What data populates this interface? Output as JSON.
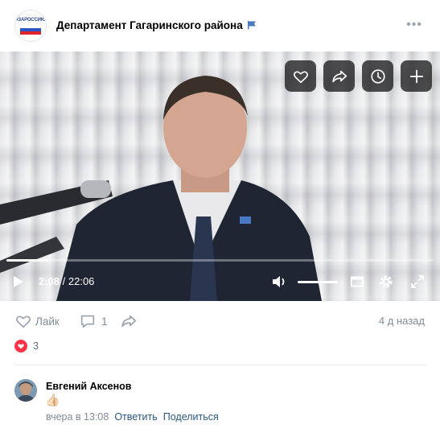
{
  "post": {
    "group_name": "Департамент Гагаринского района",
    "avatar_text": "#ЗАРОССИЮ",
    "more_label": "•••"
  },
  "video": {
    "current_time": "2:08",
    "separator": " / ",
    "total_time": "22:06",
    "progress_fraction": 0.097,
    "volume_fraction": 1.0,
    "overlay_buttons": [
      "heart-icon",
      "share-icon",
      "watch-later-icon",
      "add-icon"
    ]
  },
  "actions": {
    "like_label": "Лайк",
    "comments_count": "1",
    "posted_ago": "4 д назад"
  },
  "likes": {
    "count": "3"
  },
  "comment": {
    "author": "Евгений Аксенов",
    "text_emoji": "👍🏻",
    "time": "вчера в 13:08",
    "reply_label": "Ответить",
    "share_label": "Поделиться"
  },
  "colors": {
    "link": "#2a5885",
    "secondary_text": "#818c99",
    "like_red": "#ff3347"
  }
}
